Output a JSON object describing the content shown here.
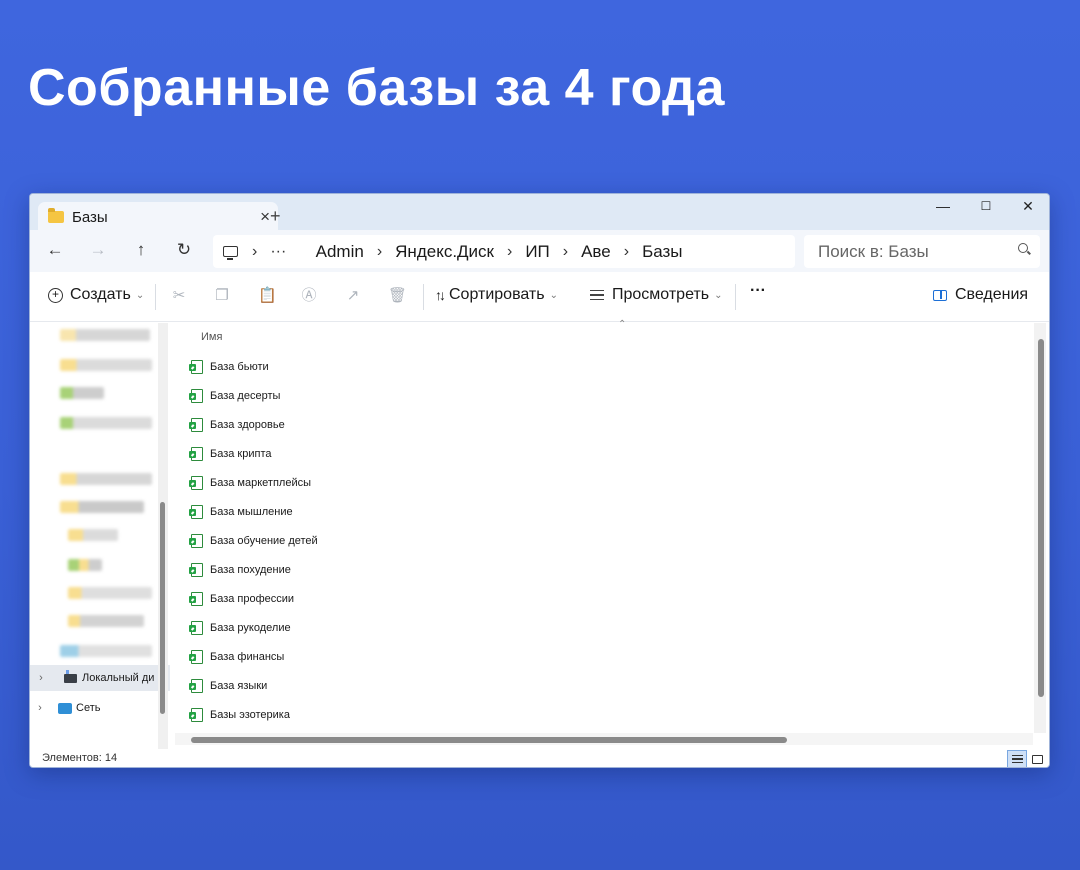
{
  "headline": "Собранные базы за 4 года",
  "window": {
    "tab": {
      "title": "Базы"
    },
    "nav": {
      "breadcrumb": {
        "more": "···",
        "items": [
          "Admin",
          "Яндекс.Диск",
          "ИП",
          "Аве",
          "Базы"
        ]
      },
      "search_placeholder": "Поиск в: Базы"
    },
    "toolbar": {
      "create_label": "Создать",
      "sort_label": "Сортировать",
      "view_label": "Просмотреть",
      "more_label": "···",
      "details_label": "Сведения"
    },
    "navpane": {
      "local_disk_label": "Локальный ди",
      "network_label": "Сеть"
    },
    "filelist": {
      "column_name": "Имя",
      "files": [
        "База бьюти",
        "База десерты",
        "База здоровье",
        "База крипта",
        "База маркетплейсы",
        "База мышление",
        "База обучение детей",
        "База похудение",
        "База профессии",
        "База рукоделие",
        "База финансы",
        "База языки",
        "Базы эзотерика"
      ]
    },
    "status": {
      "items_count": "Элементов: 14"
    }
  },
  "colors": {
    "background": "#3a63d8",
    "folder": "#f5c542",
    "excel_green": "#23a244",
    "accent": "#1c6fd6"
  }
}
